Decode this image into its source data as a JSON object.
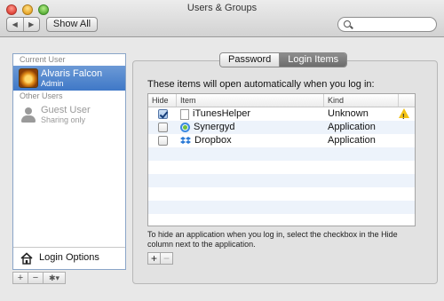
{
  "window": {
    "title": "Users & Groups"
  },
  "toolbar": {
    "back_glyph": "◀",
    "forward_glyph": "▶",
    "show_all": "Show All",
    "search_placeholder": ""
  },
  "sidebar": {
    "current_user_label": "Current User",
    "current_user": {
      "name": "Alvaris Falcon",
      "role": "Admin",
      "icon": "falcon-avatar"
    },
    "other_users_label": "Other Users",
    "other_users": [
      {
        "name": "Guest User",
        "role": "Sharing only",
        "icon": "person-icon"
      }
    ],
    "login_options": "Login Options",
    "buttons": {
      "add": "+",
      "remove": "−",
      "action": "✱▾"
    }
  },
  "tabs": {
    "password": "Password",
    "login_items": "Login Items",
    "selected": "login_items"
  },
  "login_items": {
    "intro": "These items will open automatically when you log in:",
    "columns": {
      "hide": "Hide",
      "item": "Item",
      "kind": "Kind"
    },
    "rows": [
      {
        "hide": true,
        "name": "iTunesHelper",
        "kind": "Unknown",
        "icon": "document-icon",
        "warning": true
      },
      {
        "hide": false,
        "name": "Synergyd",
        "kind": "Application",
        "icon": "synergy-icon",
        "warning": false
      },
      {
        "hide": false,
        "name": "Dropbox",
        "kind": "Application",
        "icon": "dropbox-icon",
        "warning": false
      }
    ],
    "help_text": "To hide an application when you log in, select the checkbox in the Hide column next to the application.",
    "add": "+",
    "remove": "−"
  },
  "colors": {
    "selection": "#4a7fcb",
    "warning": "#f3c316",
    "tab_active": "#7a7a7a"
  }
}
